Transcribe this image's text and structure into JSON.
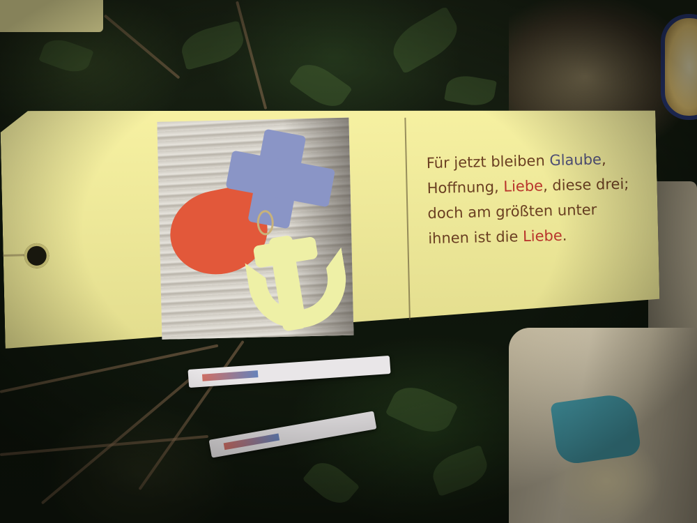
{
  "tag": {
    "verse": {
      "line1_prefix": "Für jetzt bleiben ",
      "word_glaube": "Glaube",
      "line1_suffix": ",",
      "line2_prefix": "Hoffnung, ",
      "word_liebe_1": "Liebe",
      "line2_suffix": ", diese drei;",
      "line3": "doch am größten unter",
      "line4_prefix": "ihnen ist die ",
      "word_liebe_2": "Liebe",
      "line4_suffix": "."
    },
    "colors": {
      "paper": "#f6f09a",
      "text": "#6a3f22",
      "highlight_glaube": "#52527a",
      "highlight_liebe": "#b8342c"
    },
    "photo_icons": [
      "heart-icon",
      "cross-icon",
      "anchor-icon"
    ]
  }
}
